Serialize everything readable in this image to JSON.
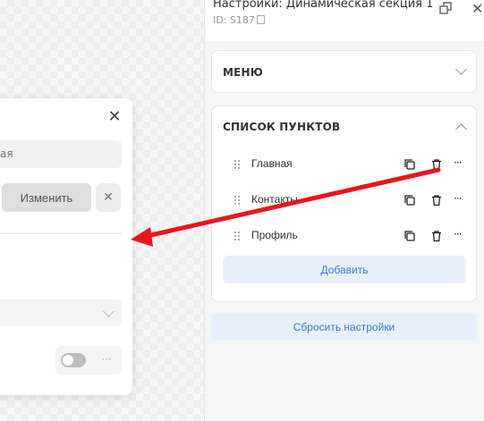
{
  "popup": {
    "field_value": "ая",
    "change_label": "Изменить",
    "clear_symbol": "✕",
    "close_symbol": "✕",
    "more_symbol": "···",
    "toggle_on": false
  },
  "panel": {
    "title": "Настройки: Динамическая секция 1",
    "id_text": "ID: S187",
    "menu_section": {
      "title": "МЕНЮ",
      "expanded": false
    },
    "list_section": {
      "title": "СПИСОК ПУНКТОВ",
      "expanded": true,
      "items": [
        {
          "label": "Главная"
        },
        {
          "label": "Контакты"
        },
        {
          "label": "Профиль"
        }
      ],
      "add_label": "Добавить"
    },
    "reset_label": "Сбросить настройки",
    "close_symbol": "✕"
  },
  "colors": {
    "accent": "#3a7bd5",
    "accent_bg": "#e8f1fb",
    "annotation_arrow": "#e8161b"
  },
  "icons": [
    "close-icon",
    "copy-icon",
    "trash-icon",
    "more-icon",
    "drag-handle-icon",
    "chevron-down-icon",
    "chevron-up-icon",
    "popout-icon"
  ]
}
